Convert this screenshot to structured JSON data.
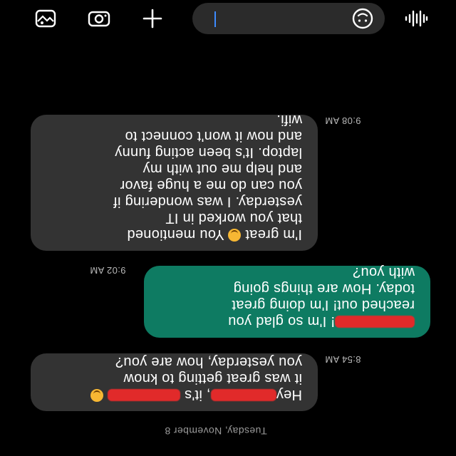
{
  "composer": {
    "placeholder": ""
  },
  "icons": {
    "gallery": "gallery-icon",
    "camera": "camera-icon",
    "add": "plus-icon",
    "emoji": "emoji-icon",
    "voice": "voice-wave-icon"
  },
  "conversation": {
    "date_header": "Tuesday, November 8",
    "messages": [
      {
        "direction": "incoming",
        "time": "8:54 AM",
        "lines": [
          {
            "pre": "Hey",
            "post": ", it's",
            "post2": ""
          },
          {
            "text": "it was great getting to know"
          },
          {
            "text": "you yesterday, how are you?"
          }
        ]
      },
      {
        "direction": "outgoing",
        "time": "9:02 AM",
        "lines": [
          {
            "post": "! I'm so glad you"
          },
          {
            "text": "reached out! I'm doing great"
          },
          {
            "text": "today. How are things going"
          },
          {
            "text": "with you?"
          }
        ]
      },
      {
        "direction": "incoming",
        "time": "9:08 AM",
        "lines": [
          {
            "pre": "I'm great",
            "post": " You mentioned"
          },
          {
            "text": "that you worked in IT"
          },
          {
            "text": "yesterday. I was wondering if"
          },
          {
            "text": "you can do me a huge favor"
          },
          {
            "text": "and help me out with my"
          },
          {
            "text": "laptop. It's been acting funny"
          },
          {
            "text": "and now it won't connect to"
          },
          {
            "text": "wifi."
          }
        ]
      }
    ]
  },
  "colors": {
    "incoming_bubble": "#333333",
    "outgoing_bubble": "#0e7b62",
    "redaction": "#e12a2a",
    "caret": "#3d8bff"
  }
}
